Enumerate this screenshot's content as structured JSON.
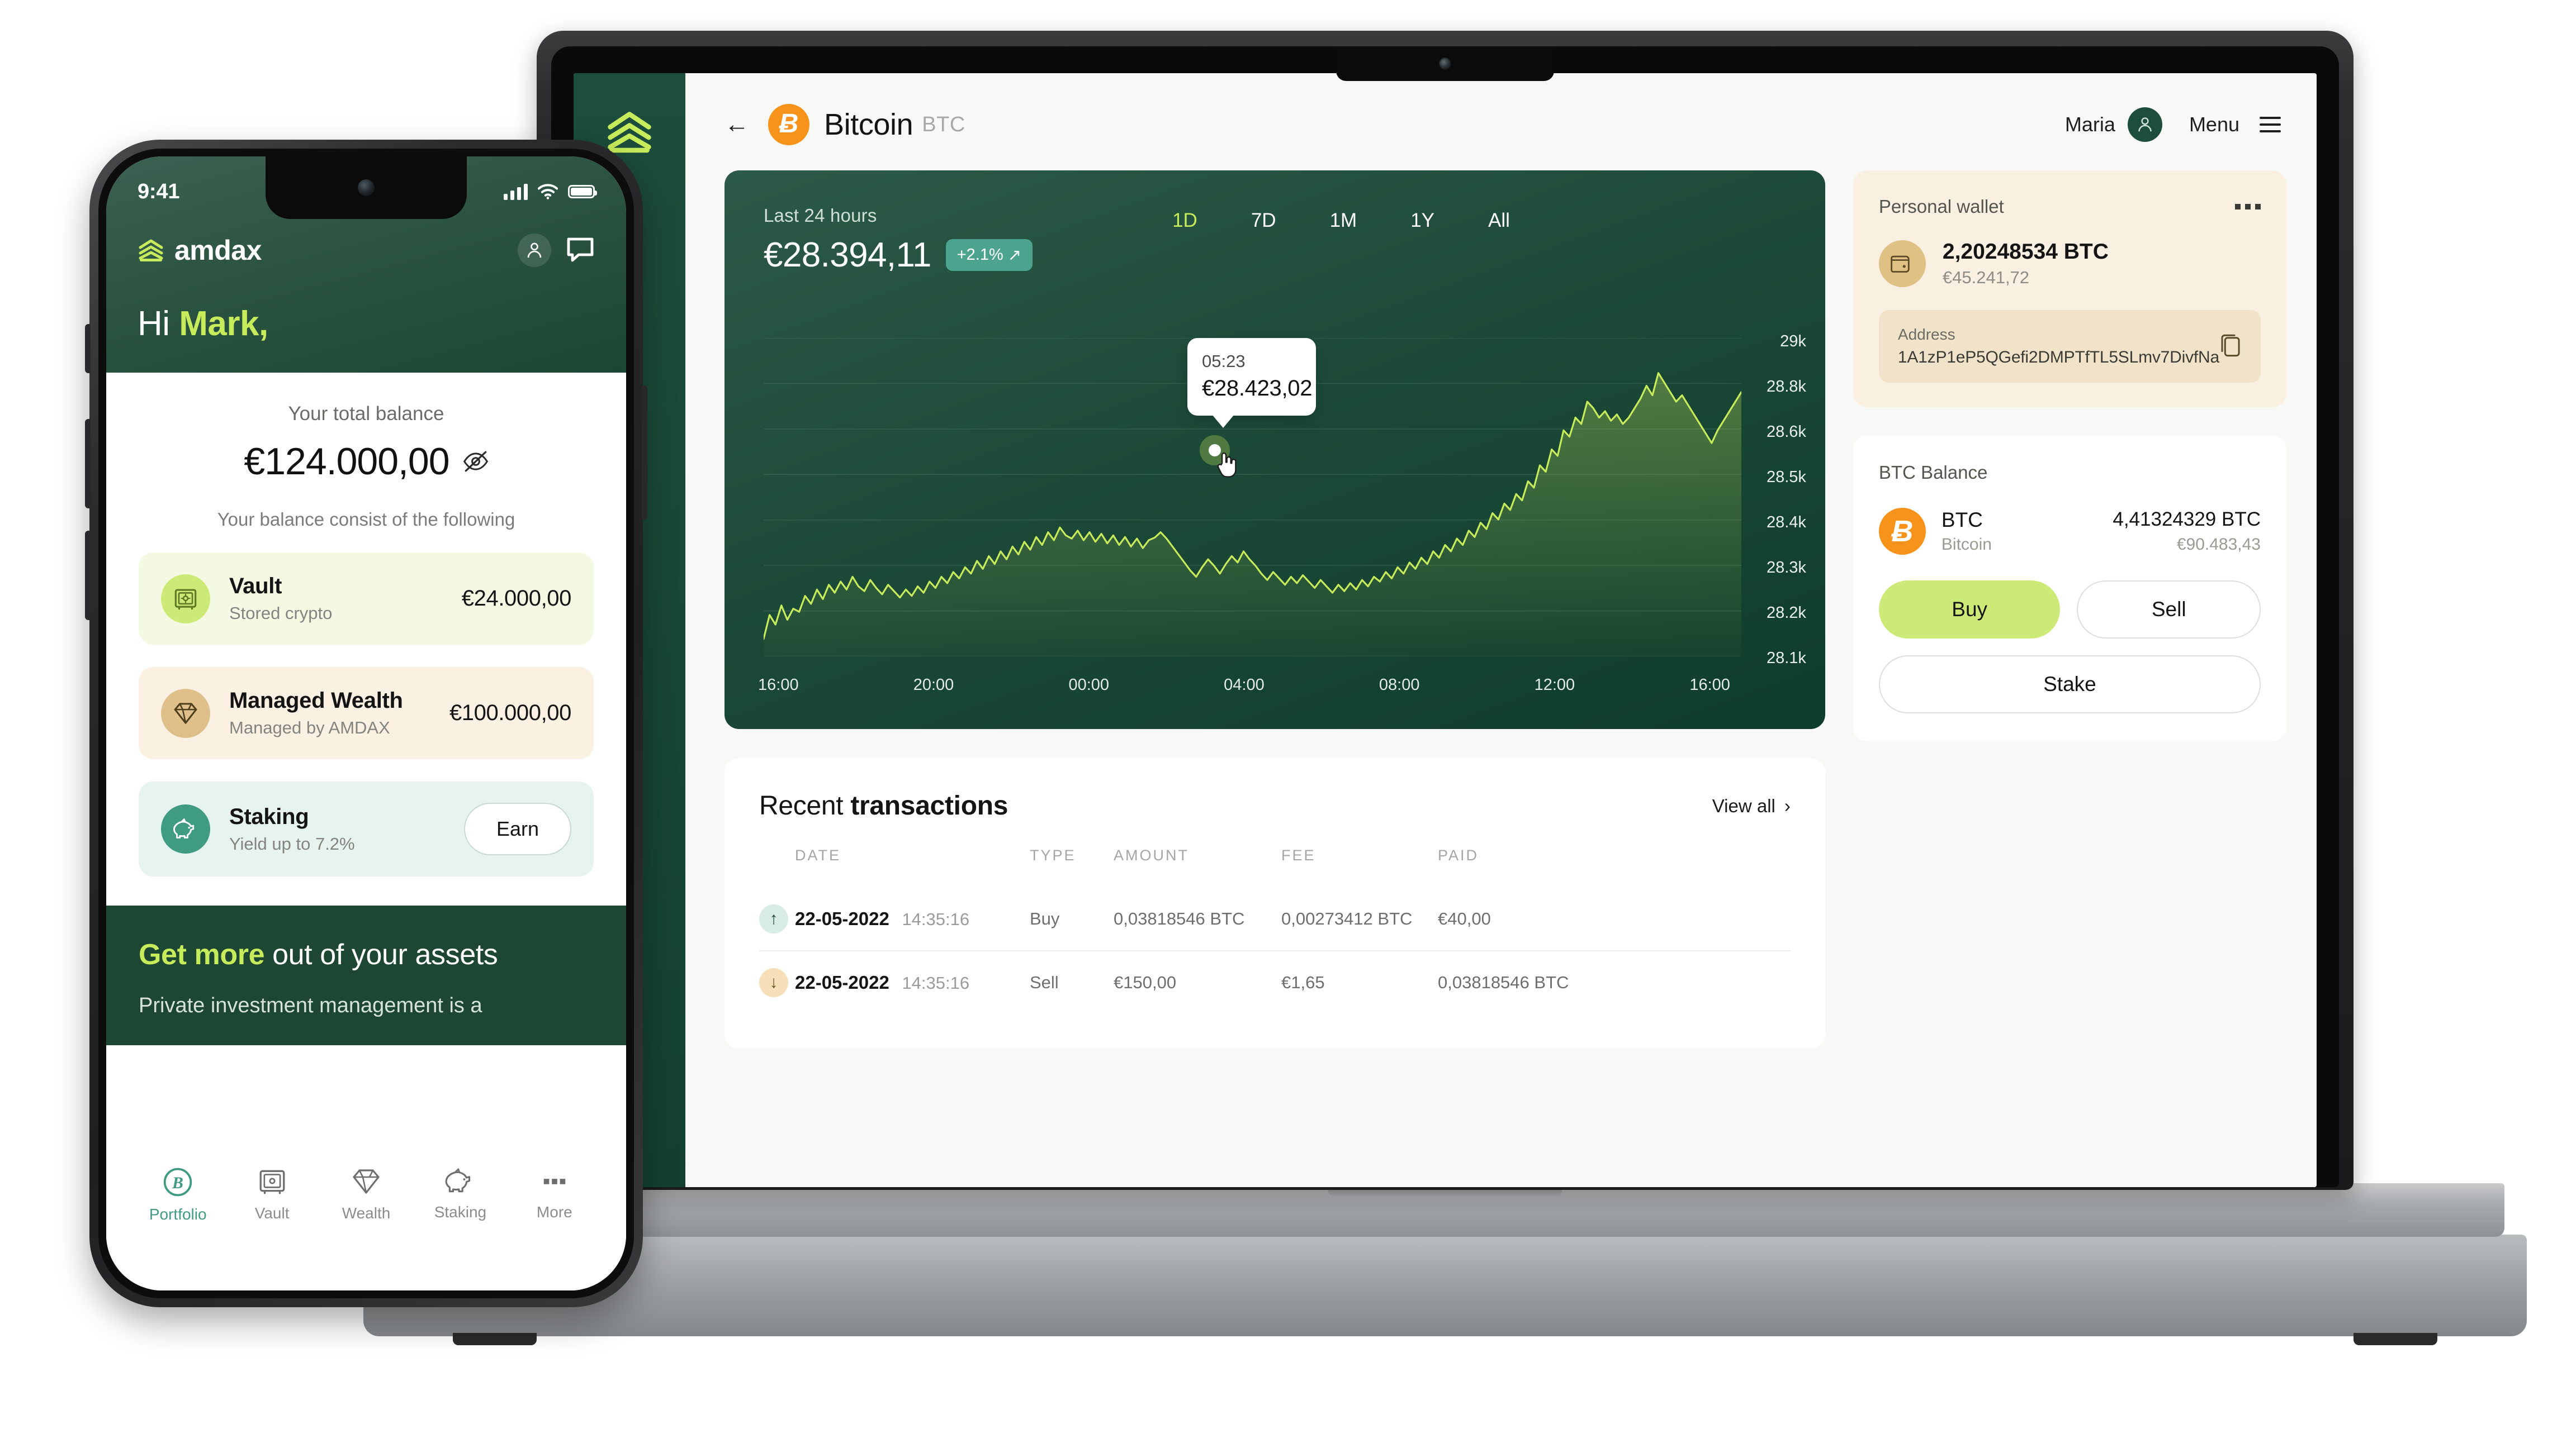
{
  "laptop": {
    "rail": {
      "logo": "amdax-logo-mark"
    },
    "header": {
      "back_icon": "back-arrow-icon",
      "coin_glyph": "Ƀ",
      "title": "Bitcoin",
      "ticker": "BTC",
      "user_name": "Maria",
      "menu_label": "Menu"
    },
    "chart": {
      "subtitle": "Last 24 hours",
      "price": "€28.394,11",
      "delta": "+2.1%",
      "delta_arrow": "↗",
      "ranges": [
        {
          "label": "1D",
          "active": true
        },
        {
          "label": "7D",
          "active": false
        },
        {
          "label": "1M",
          "active": false
        },
        {
          "label": "1Y",
          "active": false
        },
        {
          "label": "All",
          "active": false
        }
      ],
      "tooltip": {
        "time": "05:23",
        "value": "€28.423,02"
      }
    },
    "transactions": {
      "title_light": "Recent ",
      "title_bold": "transactions",
      "view_all": "View all",
      "chevron": "›",
      "columns": [
        "DATE",
        "TYPE",
        "AMOUNT",
        "FEE",
        "PAID"
      ],
      "rows": [
        {
          "direction": "up",
          "arrow": "↑",
          "date": "22-05-2022",
          "time": "14:35:16",
          "type": "Buy",
          "amount": "0,03818546 BTC",
          "fee": "0,00273412 BTC",
          "paid": "€40,00"
        },
        {
          "direction": "down",
          "arrow": "↓",
          "date": "22-05-2022",
          "time": "14:35:16",
          "type": "Sell",
          "amount": "€150,00",
          "fee": "€1,65",
          "paid": "0,03818546 BTC"
        }
      ]
    },
    "wallet": {
      "title": "Personal wallet",
      "more_icon": "more-dots-icon",
      "wallet_icon": "wallet-icon",
      "btc_amount": "2,20248534 BTC",
      "eur_amount": "€45.241,72",
      "address_label": "Address",
      "address_value": "1A1zP1eP5QGefi2DMPTfTL5SLmv7DivfNa",
      "copy_icon": "copy-icon"
    },
    "balance": {
      "title": "BTC Balance",
      "coin_glyph": "Ƀ",
      "symbol": "BTC",
      "name": "Bitcoin",
      "btc_amount": "4,41324329 BTC",
      "eur_amount": "€90.483,43",
      "buy_label": "Buy",
      "sell_label": "Sell",
      "stake_label": "Stake"
    }
  },
  "phone": {
    "status": {
      "time": "9:41",
      "signal_icon": "signal-bars-icon",
      "wifi_icon": "wifi-icon",
      "battery_icon": "battery-icon"
    },
    "brand": "amdax",
    "header_icons": {
      "profile": "profile-icon",
      "chat": "chat-bubble-icon"
    },
    "greeting_light": "Hi ",
    "greeting_bold": "Mark,",
    "balance_label": "Your total balance",
    "balance_amount": "€124.000,00",
    "eye_icon": "eye-off-icon",
    "balance_sub": "Your balance consist of the following",
    "cards": [
      {
        "icon": "safe-icon",
        "title": "Vault",
        "subtitle": "Stored crypto",
        "value": "€24.000,00",
        "action": null
      },
      {
        "icon": "diamond-icon",
        "title": "Managed Wealth",
        "subtitle": "Managed by AMDAX",
        "value": "€100.000,00",
        "action": null
      },
      {
        "icon": "piggy-bank-icon",
        "title": "Staking",
        "subtitle": "Yield up to 7.2%",
        "value": null,
        "action": "Earn"
      }
    ],
    "promo": {
      "title_bold": "Get more",
      "title_light": " out of your assets",
      "subtitle": "Private investment management is a"
    },
    "nav": [
      {
        "icon": "bitcoin-circle-icon",
        "label": "Portfolio",
        "active": true
      },
      {
        "icon": "safe-icon",
        "label": "Vault",
        "active": false
      },
      {
        "icon": "diamond-icon",
        "label": "Wealth",
        "active": false
      },
      {
        "icon": "piggy-bank-icon",
        "label": "Staking",
        "active": false
      },
      {
        "icon": "more-dots-icon",
        "label": "More",
        "active": false
      }
    ]
  },
  "chart_data": {
    "type": "area",
    "title": "Bitcoin price – Last 24 hours",
    "xlabel": "",
    "ylabel": "EUR",
    "grid": true,
    "legend": "none",
    "x_tick_labels": [
      "16:00",
      "20:00",
      "00:00",
      "04:00",
      "08:00",
      "12:00",
      "16:00"
    ],
    "y_tick_labels": [
      "29k",
      "28.8k",
      "28.6k",
      "28.5k",
      "28.4k",
      "28.3k",
      "28.2k",
      "28.1k"
    ],
    "ylim": [
      28050,
      29050
    ],
    "annotation": {
      "x": "05:23",
      "y": 28423.02,
      "label": "€28.423,02"
    },
    "series": [
      {
        "name": "BTC/EUR",
        "color": "#c6eb5b",
        "values": [
          28105,
          28180,
          28150,
          28210,
          28165,
          28200,
          28190,
          28240,
          28215,
          28260,
          28230,
          28275,
          28250,
          28285,
          28260,
          28300,
          28270,
          28255,
          28290,
          28265,
          28245,
          28275,
          28255,
          28235,
          28260,
          28240,
          28270,
          28250,
          28285,
          28265,
          28300,
          28280,
          28315,
          28295,
          28330,
          28310,
          28350,
          28325,
          28365,
          28340,
          28380,
          28355,
          28395,
          28370,
          28410,
          28385,
          28425,
          28400,
          28440,
          28415,
          28455,
          28430,
          28420,
          28445,
          28415,
          28440,
          28410,
          28435,
          28405,
          28430,
          28400,
          28425,
          28395,
          28420,
          28390,
          28415,
          28423,
          28440,
          28420,
          28395,
          28370,
          28345,
          28320,
          28300,
          28330,
          28355,
          28335,
          28310,
          28340,
          28365,
          28345,
          28380,
          28355,
          28335,
          28310,
          28290,
          28315,
          28295,
          28275,
          28300,
          28280,
          28305,
          28285,
          28265,
          28290,
          28270,
          28250,
          28275,
          28255,
          28280,
          28260,
          28290,
          28270,
          28300,
          28285,
          28315,
          28295,
          28330,
          28310,
          28345,
          28325,
          28360,
          28340,
          28380,
          28360,
          28400,
          28380,
          28420,
          28400,
          28445,
          28425,
          28470,
          28450,
          28500,
          28480,
          28530,
          28510,
          28560,
          28540,
          28600,
          28580,
          28650,
          28630,
          28700,
          28680,
          28760,
          28740,
          28800,
          28780,
          28850,
          28830,
          28800,
          28820,
          28790,
          28810,
          28780,
          28800,
          28830,
          28860,
          28900,
          28870,
          28940,
          28910,
          28880,
          28850,
          28870,
          28840,
          28810,
          28780,
          28750,
          28720,
          28760,
          28790,
          28820,
          28850,
          28880
        ]
      }
    ]
  }
}
